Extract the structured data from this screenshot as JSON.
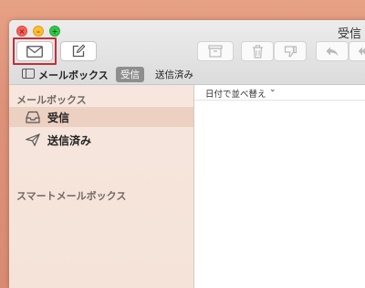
{
  "window": {
    "title": "受信"
  },
  "toolbar": {
    "compose_icon": "mail-envelope-icon",
    "new_message_icon": "compose-pencil-icon"
  },
  "mailbox_bar": {
    "label": "メールボックス",
    "tab_inbox": "受信",
    "tab_sent": "送信済み"
  },
  "sidebar": {
    "section_mailboxes": "メールボックス",
    "items": [
      {
        "label": "受信",
        "icon": "inbox-tray-icon",
        "selected": true
      },
      {
        "label": "送信済み",
        "icon": "paper-plane-icon",
        "selected": false
      }
    ],
    "section_smart": "スマートメールボックス"
  },
  "list": {
    "sort_label": "日付で並べ替え",
    "sort_chevron": "⌄"
  },
  "colors": {
    "highlight_box": "#c0303a",
    "sidebar_bg": "#f6e6dd",
    "selected_row": "#ecd0c2"
  }
}
